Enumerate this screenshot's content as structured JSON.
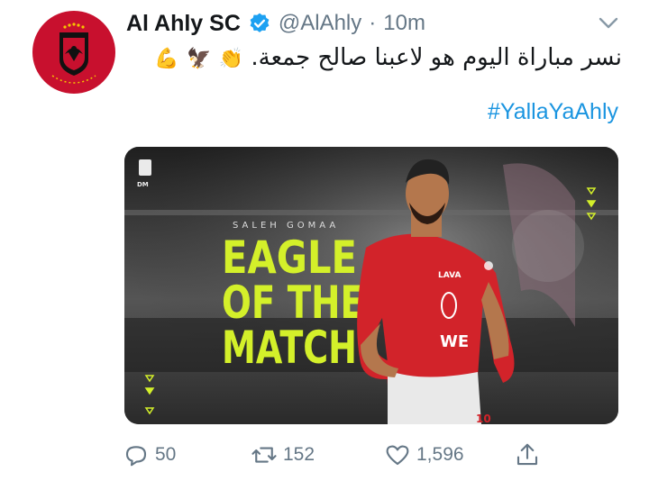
{
  "account": {
    "display_name": "Al Ahly SC",
    "handle": "@AlAhly",
    "separator": "·",
    "time": "10m",
    "avatar_icon": "al-ahly-eagle-logo",
    "verified_icon": "verified-badge-icon"
  },
  "tweet": {
    "text": "نسر مباراة اليوم هو لاعبنا صالح جمعة.",
    "emojis": [
      "👏",
      "🦅",
      "💪"
    ],
    "hashtag": "#YallaYaAhly"
  },
  "media": {
    "player_name": "SALEH GOMAA",
    "headline_lines": [
      "EAGLE",
      "OF THE",
      "MATCH"
    ],
    "shirt_sponsor": "WE",
    "shirt_brand": "LAVA",
    "shirt_number": "10",
    "corner_logo_text": "DM",
    "accent_color": "#d4f02a",
    "shirt_color": "#d2232a"
  },
  "actions": {
    "replies": "50",
    "retweets": "152",
    "likes": "1,596"
  },
  "colors": {
    "link": "#1b95e0",
    "muted": "#657786",
    "verified": "#1da1f2"
  }
}
